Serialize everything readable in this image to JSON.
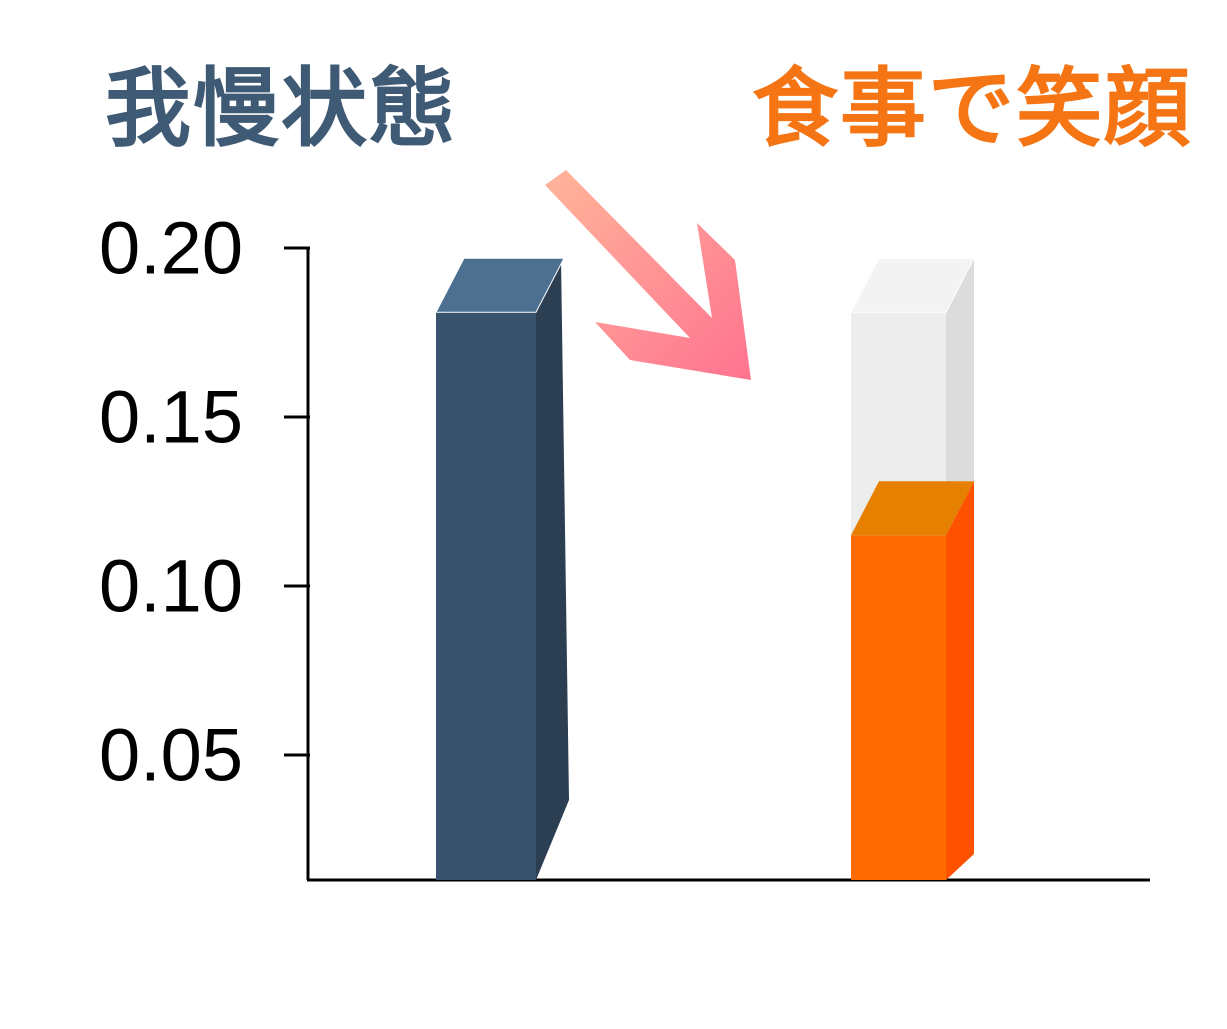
{
  "chart_data": {
    "type": "bar",
    "categories": [
      "我慢状態",
      "食事で笑顔"
    ],
    "values": [
      0.181,
      0.115
    ],
    "reference_value": 0.181,
    "yticks": [
      "0.20",
      "0.15",
      "0.10",
      "0.05"
    ],
    "ytick_values": [
      0.2,
      0.15,
      0.1,
      0.05
    ],
    "ylim": [
      0.013,
      0.2
    ],
    "grid": false,
    "legend": "none"
  },
  "colors": {
    "left_label": "#3f5a74",
    "right_label": "#f57414",
    "bar_left_front": "#37536e",
    "bar_left_side": "#2b3e52",
    "bar_left_top": "#4e7090",
    "bar_right_front": "#ff6b00",
    "bar_right_side": "#ff5200",
    "bar_right_top": "#e58000",
    "ghost_front": "#ededed",
    "ghost_side": "#dcdcdc",
    "ghost_top": "#f3f3f3",
    "arrow_start": "#ffb59a",
    "arrow_end": "#ff7390"
  },
  "icons": {
    "arrow": "down-right-arrow-icon"
  }
}
